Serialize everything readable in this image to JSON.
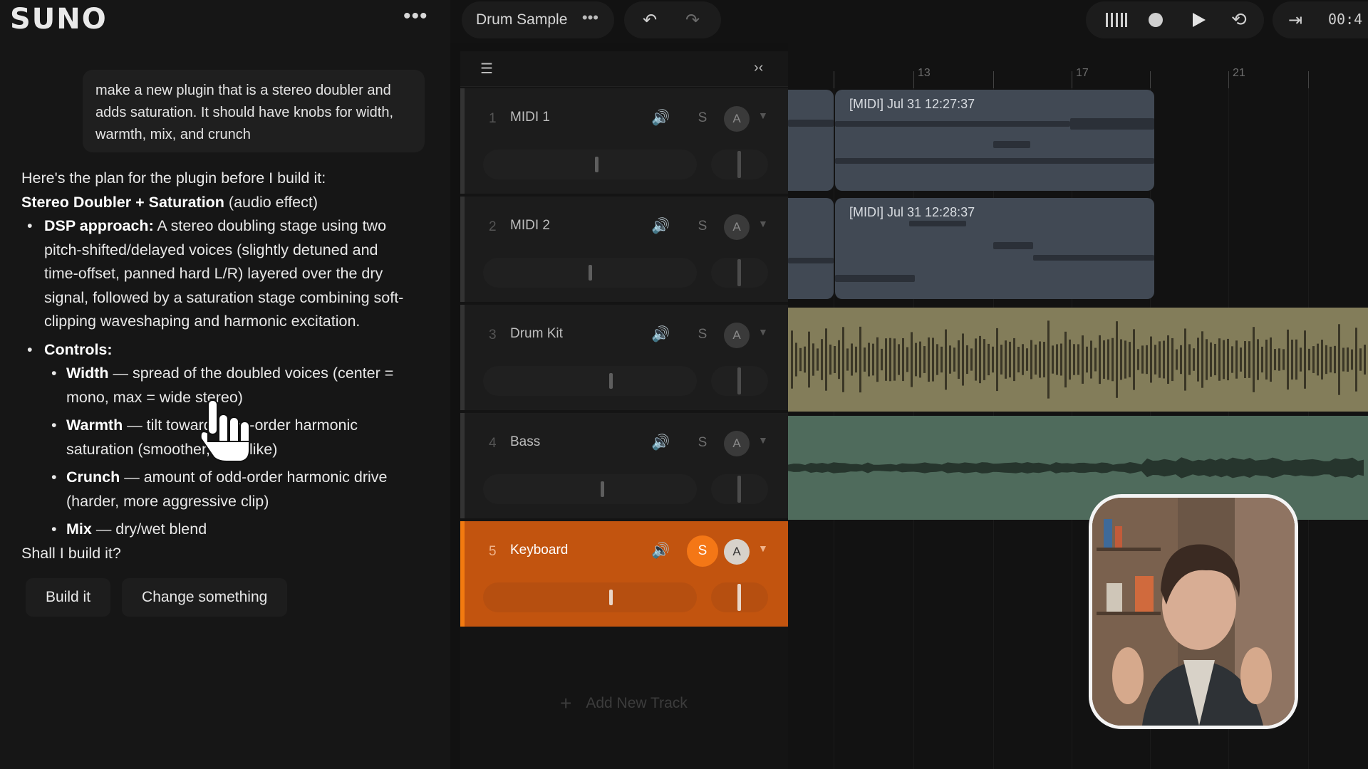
{
  "app": {
    "logo": "SUNO",
    "more_icon": "•••"
  },
  "chat": {
    "user_message": "make a new plugin that is a stereo doubler and adds saturation. It should have knobs for width, warmth, mix, and crunch",
    "reply": {
      "intro": "Here's the plan for the plugin before I build it:",
      "title_bold": "Stereo Doubler + Saturation",
      "title_rest": " (audio effect)",
      "dsp_label": "DSP approach:",
      "dsp_lines": [
        " A stereo doubling stage using two",
        "pitch-shifted/delayed voices (slightly detuned and",
        "time-offset, panned hard L/R) layered over the dry",
        "signal, followed by a saturation stage combining soft-",
        "clipping waveshaping and harmonic excitation."
      ],
      "controls_label": "Controls:",
      "controls": [
        {
          "name": "Width",
          "lines": [
            " — spread of the doubled voices (center =",
            "mono, max = wide stereo)"
          ]
        },
        {
          "name": "Warmth",
          "lines": [
            " — tilt toward even-order harmonic",
            "saturation (smoother, tape-like)"
          ]
        },
        {
          "name": "Crunch",
          "lines": [
            " — amount of odd-order harmonic drive",
            "(harder, more aggressive clip)"
          ]
        },
        {
          "name": "Mix",
          "lines": [
            " — dry/wet blend"
          ]
        }
      ],
      "question": "Shall I build it?"
    },
    "actions": {
      "build": "Build it",
      "change": "Change something"
    }
  },
  "topbar": {
    "project_title": "Drum Sample",
    "project_more": "•••",
    "time": "00:4"
  },
  "tracks": [
    {
      "num": "1",
      "name": "MIDI 1",
      "solo": "S",
      "arm": "A",
      "color": "#5f6a7a",
      "volume": 0.54
    },
    {
      "num": "2",
      "name": "MIDI 2",
      "solo": "S",
      "arm": "A",
      "color": "#5f6a7a",
      "volume": 0.51
    },
    {
      "num": "3",
      "name": "Drum Kit",
      "solo": "S",
      "arm": "A",
      "color": "#8d8762",
      "volume": 0.61
    },
    {
      "num": "4",
      "name": "Bass",
      "solo": "S",
      "arm": "A",
      "color": "#557060",
      "volume": 0.57
    },
    {
      "num": "5",
      "name": "Keyboard",
      "solo": "S",
      "arm": "A",
      "color": "#f27a10",
      "volume": 0.61,
      "selected": true
    }
  ],
  "add_track_label": "Add New Track",
  "ruler": {
    "labels": [
      "13",
      "17",
      "21"
    ]
  },
  "clips": [
    {
      "track": 1,
      "label": "[MIDI] Jul 31 12:27:37"
    },
    {
      "track": 2,
      "label": "[MIDI] Jul 31 12:28:37"
    }
  ],
  "colors": {
    "accent": "#f47716",
    "drum_lane": "#837d5a",
    "bass_lane": "#4f6b5c",
    "midi_clip": "#414954"
  }
}
